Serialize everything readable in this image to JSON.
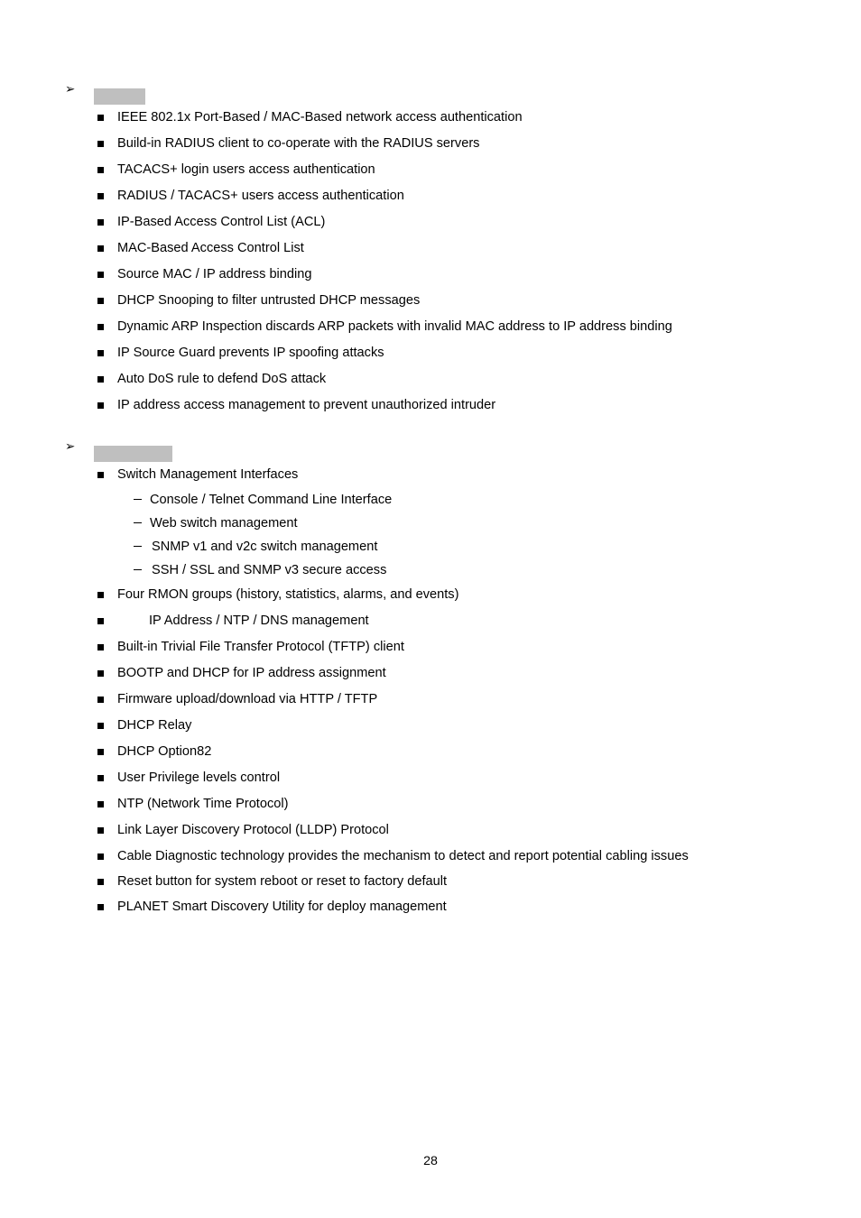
{
  "document": {
    "page_number": "28",
    "redaction_color": "#bfbfbf",
    "text_color": "#000000",
    "background_color": "#ffffff"
  },
  "icons": {
    "arrow": "➢",
    "square_bullet": "■",
    "dash_bullet": "–"
  },
  "sections": [
    {
      "heading": "",
      "heading_redacted": true,
      "items": [
        {
          "text": "IEEE 802.1x Port-Based / MAC-Based network access authentication"
        },
        {
          "text": "Build-in RADIUS client to co-operate with the RADIUS servers"
        },
        {
          "text": "TACACS+ login users access authentication"
        },
        {
          "text": "RADIUS / TACACS+ users access authentication"
        },
        {
          "text": "IP-Based Access Control List (ACL)"
        },
        {
          "text": "MAC-Based Access Control List"
        },
        {
          "text": "Source MAC / IP address binding"
        },
        {
          "text": "DHCP Snooping to filter untrusted DHCP messages"
        },
        {
          "text": "Dynamic ARP Inspection discards ARP packets with invalid MAC address to IP address binding"
        },
        {
          "text": "IP Source Guard prevents IP spoofing attacks"
        },
        {
          "text": "Auto DoS rule to defend DoS attack"
        },
        {
          "text": "IP address access management to prevent unauthorized intruder"
        }
      ]
    },
    {
      "heading": "",
      "heading_redacted": true,
      "items": [
        {
          "text": "Switch Management Interfaces"
        },
        {
          "text": "Four RMON groups (history, statistics, alarms, and events)"
        },
        {
          "text": "IP Address / NTP / DNS management"
        },
        {
          "text": "Built-in Trivial File Transfer Protocol (TFTP) client"
        },
        {
          "text": "BOOTP and DHCP for IP address assignment"
        },
        {
          "text": "Firmware upload/download via HTTP / TFTP"
        },
        {
          "text": "DHCP Relay"
        },
        {
          "text": "DHCP Option82"
        },
        {
          "text": "User Privilege levels control"
        },
        {
          "text": "NTP (Network Time Protocol)"
        },
        {
          "text": "Link Layer Discovery Protocol (LLDP) Protocol"
        },
        {
          "text": "Cable Diagnostic technology provides the mechanism to detect and report potential cabling issues"
        },
        {
          "text": "Reset button for system reboot or reset to factory default"
        },
        {
          "text": "PLANET Smart Discovery Utility for deploy management"
        }
      ],
      "sub_items": [
        {
          "text": "Console / Telnet Command Line Interface"
        },
        {
          "text": "Web switch management"
        },
        {
          "text": "SNMP v1 and v2c switch management"
        },
        {
          "text": "SSH / SSL and SNMP v3 secure access"
        }
      ]
    }
  ]
}
